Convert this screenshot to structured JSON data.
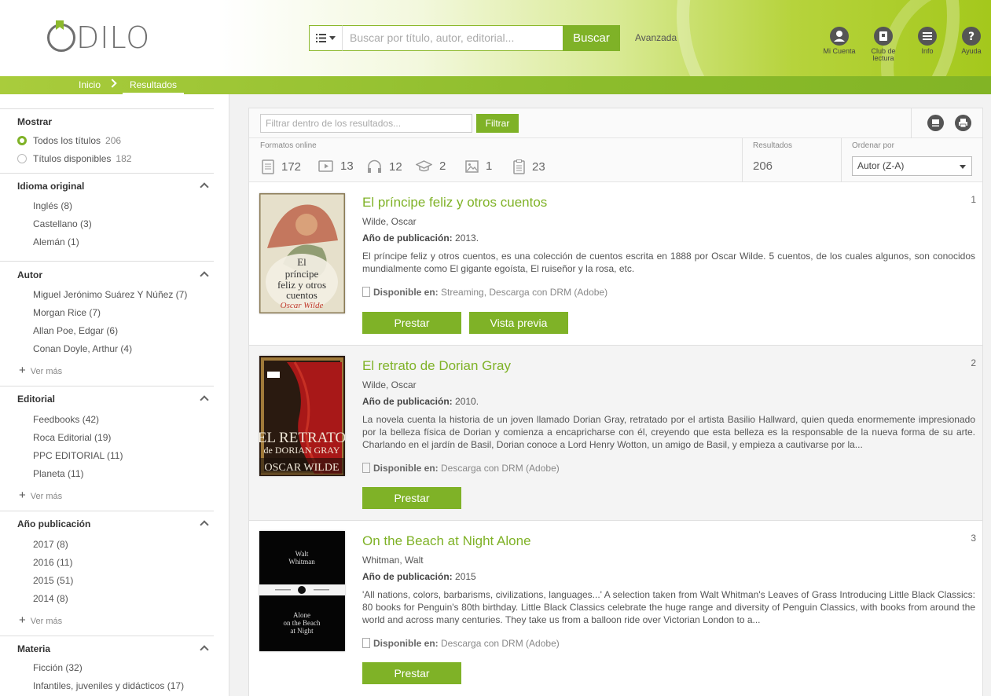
{
  "header": {
    "logo_text": "DILO",
    "search_placeholder": "Buscar por título, autor, editorial...",
    "search_button": "Buscar",
    "advanced": "Avanzada",
    "tools": [
      {
        "label": "Mi Cuenta",
        "icon": "user-icon"
      },
      {
        "label": "Club de lectura",
        "icon": "book-club-icon"
      },
      {
        "label": "Info",
        "icon": "menu-icon"
      },
      {
        "label": "Ayuda",
        "icon": "help-icon"
      }
    ]
  },
  "breadcrumb": {
    "home": "Inicio",
    "current": "Resultados"
  },
  "sidebar": {
    "mostrar": {
      "title": "Mostrar",
      "options": [
        {
          "label": "Todos los títulos",
          "count": "206",
          "selected": true
        },
        {
          "label": "Títulos disponibles",
          "count": "182",
          "selected": false
        }
      ]
    },
    "idioma": {
      "title": "Idioma original",
      "items": [
        "Inglés (8)",
        "Castellano (3)",
        "Alemán (1)"
      ]
    },
    "autor": {
      "title": "Autor",
      "items": [
        "Miguel Jerónimo Suárez Y Núñez (7)",
        "Morgan Rice (7)",
        "Allan Poe, Edgar (6)",
        "Conan Doyle, Arthur (4)"
      ],
      "more": "Ver más"
    },
    "editorial": {
      "title": "Editorial",
      "items": [
        "Feedbooks (42)",
        "Roca Editorial (19)",
        "PPC EDITORIAL (11)",
        "Planeta (11)"
      ],
      "more": "Ver más"
    },
    "anio": {
      "title": "Año publicación",
      "items": [
        "2017 (8)",
        "2016 (11)",
        "2015 (51)",
        "2014 (8)"
      ],
      "more": "Ver más"
    },
    "materia": {
      "title": "Materia",
      "items": [
        "Ficción (32)",
        "Infantiles, juveniles y didácticos (17)"
      ]
    }
  },
  "toolbar": {
    "filter_placeholder": "Filtrar dentro de los resultados...",
    "filter_button": "Filtrar"
  },
  "stats": {
    "formats_label": "Formatos online",
    "formats": [
      {
        "icon": "ebook-icon",
        "count": "172"
      },
      {
        "icon": "video-icon",
        "count": "13"
      },
      {
        "icon": "audiobook-icon",
        "count": "12"
      },
      {
        "icon": "elearning-icon",
        "count": "2"
      },
      {
        "icon": "image-icon",
        "count": "1"
      },
      {
        "icon": "document-icon",
        "count": "23"
      }
    ],
    "results_label": "Resultados",
    "results_count": "206",
    "sort_label": "Ordenar por",
    "sort_value": "Autor (Z-A)"
  },
  "results": [
    {
      "num": "1",
      "title": "El príncipe feliz y otros cuentos",
      "author": "Wilde, Oscar",
      "year_label": "Año de publicación:",
      "year": "2013.",
      "description": "El príncipe feliz y otros cuentos, es una colección de cuentos escrita en 1888 por Oscar Wilde. 5 cuentos, de los cuales algunos, son conocidos mundialmente como El gigante egoísta, El ruiseñor y la rosa, etc.",
      "avail_label": "Disponible en:",
      "avail": "Streaming, Descarga con DRM (Adobe)",
      "buttons": [
        "Prestar",
        "Vista previa"
      ],
      "cover_lines": [
        "El",
        "príncipe",
        "feliz y otros",
        "cuentos",
        "Oscar Wilde"
      ]
    },
    {
      "num": "2",
      "title": "El retrato de Dorian Gray",
      "author": "Wilde, Oscar",
      "year_label": "Año de publicación:",
      "year": "2010.",
      "description": "La novela cuenta la historia de un joven llamado Dorian Gray, retratado por el artista Basilio Hallward, quien queda enormemente impresionado por la belleza física de Dorian y comienza a encapricharse con él, creyendo que esta belleza es la responsable de la nueva forma de su arte. Charlando en el jardín de Basil, Dorian conoce a Lord Henry Wotton, un amigo de Basil, y empieza a cautivarse por la...",
      "avail_label": "Disponible en:",
      "avail": "Descarga con DRM (Adobe)",
      "buttons": [
        "Prestar"
      ],
      "cover_lines": [
        "EL RETRATO",
        "de DORIAN GRAY",
        "OSCAR WILDE"
      ]
    },
    {
      "num": "3",
      "title": "On the Beach at Night Alone",
      "author": "Whitman, Walt",
      "year_label": "Año de publicación:",
      "year": "2015",
      "description": "'All nations, colors, barbarisms, civilizations, languages...' A selection taken from Walt Whitman's Leaves of Grass Introducing Little Black Classics: 80 books for Penguin's 80th birthday. Little Black Classics celebrate the huge range and diversity of Penguin Classics, with books from around the world and across many centuries. They take us from a balloon ride over Victorian London to a...",
      "avail_label": "Disponible en:",
      "avail": "Descarga con DRM (Adobe)",
      "buttons": [
        "Prestar"
      ],
      "cover_lines": [
        "Walt",
        "Whitman",
        "Alone",
        "on the Beach",
        "at Night"
      ]
    }
  ],
  "colors": {
    "accent": "#7fb227",
    "title_green": "#7fb227"
  }
}
